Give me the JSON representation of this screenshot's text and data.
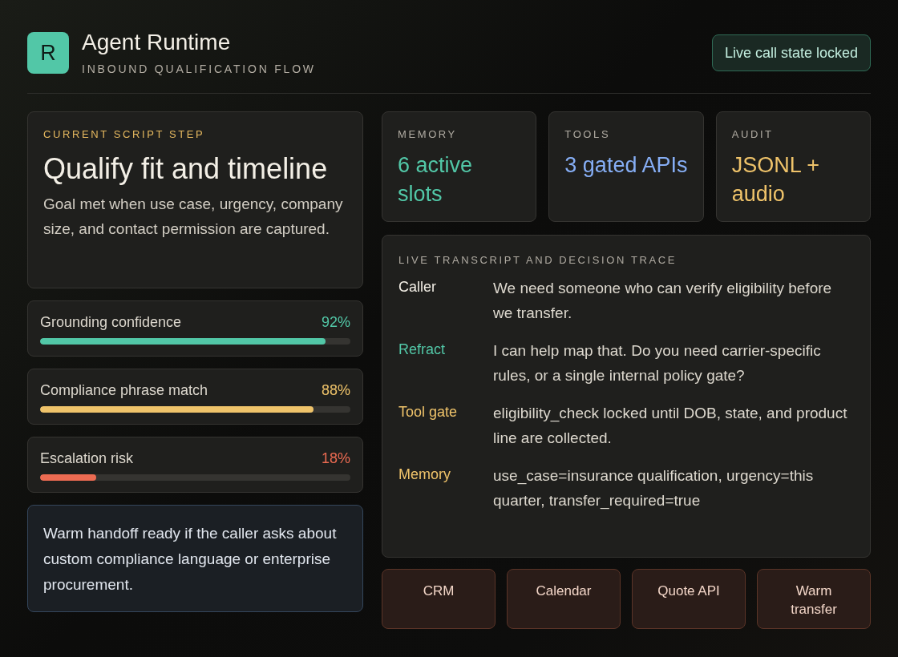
{
  "header": {
    "logo": "R",
    "title": "Agent Runtime",
    "subtitle": "INBOUND QUALIFICATION FLOW",
    "status_badge": "Live call state locked"
  },
  "script_step": {
    "label": "CURRENT SCRIPT STEP",
    "title": "Qualify fit and timeline",
    "description": "Goal met when use case, urgency, company size, and contact permission are captured."
  },
  "metrics": [
    {
      "label": "Grounding confidence",
      "value": "92%",
      "level": 0.92,
      "color": "#52c7a7"
    },
    {
      "label": "Compliance phrase match",
      "value": "88%",
      "level": 0.88,
      "color": "#efc36a"
    },
    {
      "label": "Escalation risk",
      "value": "18%",
      "level": 0.18,
      "color": "#ec6b52"
    }
  ],
  "handoff_note": "Warm handoff ready if the caller asks about custom compliance language or enterprise procurement.",
  "stats": [
    {
      "label": "MEMORY",
      "value": "6 active slots",
      "color": "#52c7a7"
    },
    {
      "label": "TOOLS",
      "value": "3 gated APIs",
      "color": "#86aef5"
    },
    {
      "label": "AUDIT",
      "value": "JSONL + audio",
      "color": "#efc36a"
    }
  ],
  "transcript": {
    "title": "LIVE TRANSCRIPT AND DECISION TRACE",
    "entries": [
      {
        "speaker": "Caller",
        "color": "#f3efe6",
        "text": "We need someone who can verify eligibility before we transfer."
      },
      {
        "speaker": "Refract",
        "color": "#52c7a7",
        "text": "I can help map that. Do you need carrier-specific rules, or a single internal policy gate?"
      },
      {
        "speaker": "Tool gate",
        "color": "#efc36a",
        "text": "eligibility_check locked until DOB, state, and product line are collected."
      },
      {
        "speaker": "Memory",
        "color": "#efc36a",
        "text": "use_case=insurance qualification, urgency=this quarter, transfer_required=true"
      }
    ]
  },
  "actions": [
    "CRM",
    "Calendar",
    "Quote API",
    "Warm transfer"
  ]
}
